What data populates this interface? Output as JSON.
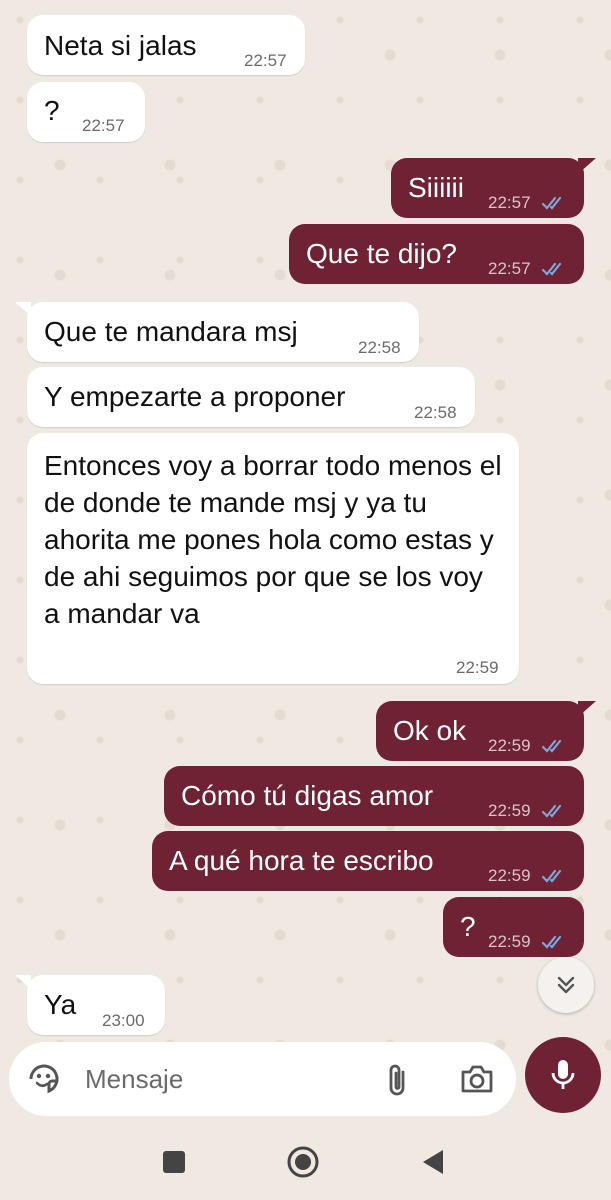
{
  "messages": [
    {
      "dir": "in",
      "text": "Neta si jalas",
      "time": "22:57"
    },
    {
      "dir": "in",
      "text": "?",
      "time": "22:57"
    },
    {
      "dir": "out",
      "text": "Siiiiii",
      "time": "22:57",
      "status": "read"
    },
    {
      "dir": "out",
      "text": "Que te dijo?",
      "time": "22:57",
      "status": "read"
    },
    {
      "dir": "in",
      "text": "Que te mandara msj",
      "time": "22:58"
    },
    {
      "dir": "in",
      "text": "Y empezarte a proponer",
      "time": "22:58"
    },
    {
      "dir": "in",
      "text": "Entonces voy a borrar todo menos el de donde te mande msj y ya tu ahorita me pones hola como estas y de ahi seguimos por que se los voy a mandar va",
      "time": "22:59"
    },
    {
      "dir": "out",
      "text": "Ok ok",
      "time": "22:59",
      "status": "read"
    },
    {
      "dir": "out",
      "text": "Cómo tú digas amor",
      "time": "22:59",
      "status": "read"
    },
    {
      "dir": "out",
      "text": "A qué hora te escribo",
      "time": "22:59",
      "status": "read"
    },
    {
      "dir": "out",
      "text": "?",
      "time": "22:59",
      "status": "read"
    },
    {
      "dir": "in",
      "text": "Ya",
      "time": "23:00"
    }
  ],
  "composer": {
    "placeholder": "Mensaje",
    "emoji_icon": "sticker-icon",
    "attach_icon": "paperclip-icon",
    "camera_icon": "camera-icon",
    "mic_icon": "microphone-icon"
  },
  "scroll_down_icon": "double-chevron-down-icon",
  "navbar": {
    "recents_icon": "square-icon",
    "home_icon": "circle-icon",
    "back_icon": "triangle-back-icon"
  },
  "colors": {
    "outgoing_bubble": "#6e2233",
    "incoming_bubble": "#ffffff",
    "background": "#efe9e1",
    "read_ticks": "#7aa8e0"
  }
}
